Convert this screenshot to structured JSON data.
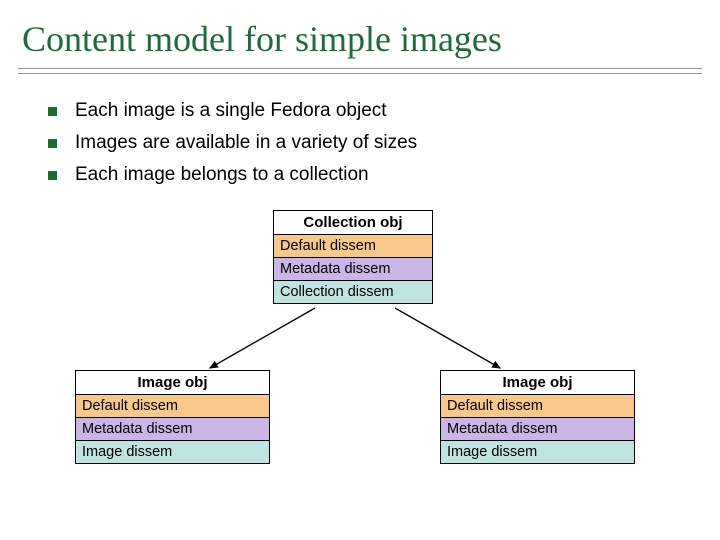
{
  "title": "Content model for simple images",
  "bullets": [
    "Each image is a single Fedora object",
    "Images are available in a variety of sizes",
    "Each image belongs to a collection"
  ],
  "collection": {
    "title": "Collection obj",
    "rows": [
      "Default dissem",
      "Metadata dissem",
      "Collection dissem"
    ]
  },
  "image_left": {
    "title": "Image obj",
    "rows": [
      "Default dissem",
      "Metadata dissem",
      "Image dissem"
    ]
  },
  "image_right": {
    "title": "Image obj",
    "rows": [
      "Default dissem",
      "Metadata dissem",
      "Image dissem"
    ]
  }
}
